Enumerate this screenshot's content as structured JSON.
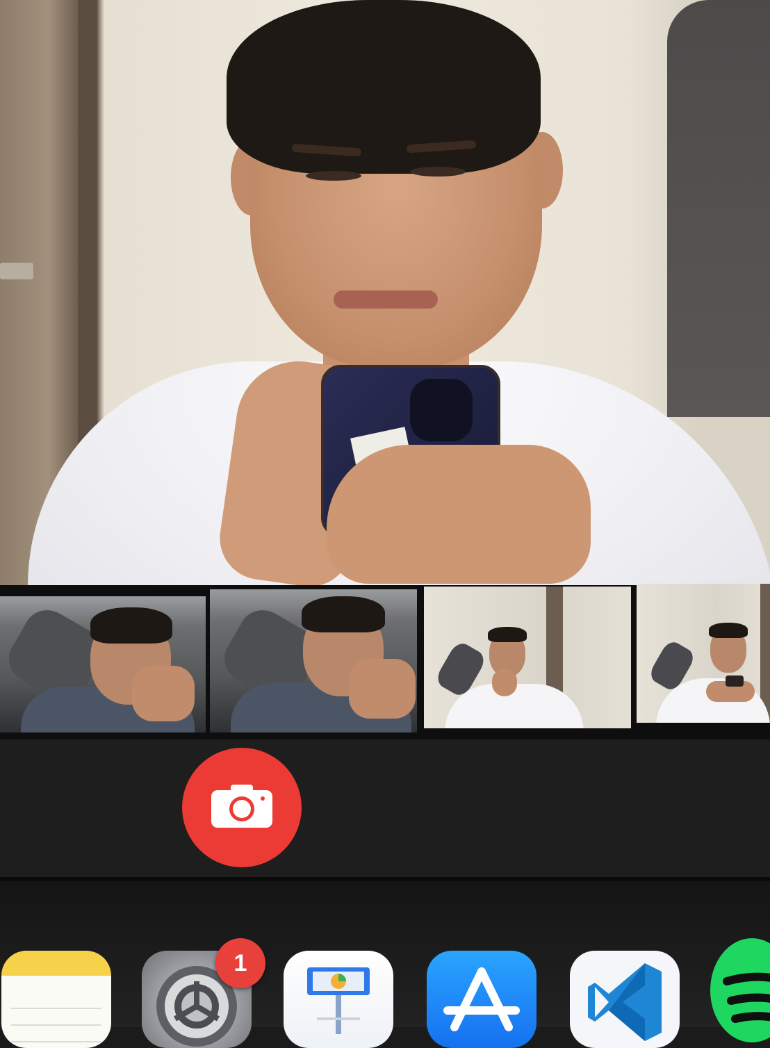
{
  "preview": {
    "label": "main-camera-preview"
  },
  "participants": [
    {
      "tile": "participant-tile-1"
    },
    {
      "tile": "participant-tile-2"
    },
    {
      "tile": "participant-tile-3"
    },
    {
      "tile": "participant-tile-4"
    }
  ],
  "toolbar": {
    "shutter_icon": "camera-icon",
    "shutter_color": "#eb3b34"
  },
  "dock": {
    "apps": [
      {
        "icon": "notes-icon"
      },
      {
        "icon": "system-settings-icon",
        "badge": "1"
      },
      {
        "icon": "keynote-icon"
      },
      {
        "icon": "app-store-icon"
      },
      {
        "icon": "vscode-icon"
      },
      {
        "icon": "spotify-icon"
      }
    ],
    "badge_color": "#e8413c"
  }
}
